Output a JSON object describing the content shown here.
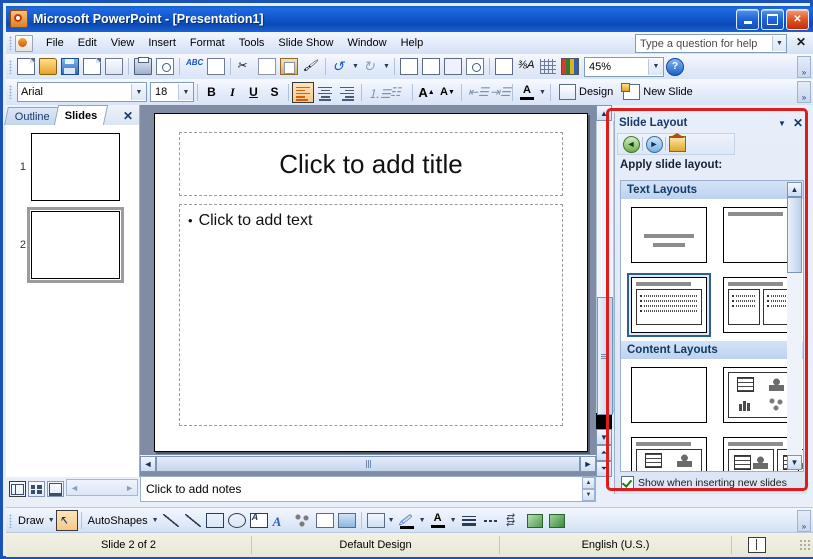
{
  "window": {
    "title": "Microsoft PowerPoint - [Presentation1]",
    "app_icon": "powerpoint-icon",
    "minimize": "_",
    "maximize": "□",
    "close": "✕"
  },
  "menu": {
    "items": [
      {
        "label": "File"
      },
      {
        "label": "Edit"
      },
      {
        "label": "View"
      },
      {
        "label": "Insert"
      },
      {
        "label": "Format"
      },
      {
        "label": "Tools"
      },
      {
        "label": "Slide Show"
      },
      {
        "label": "Window"
      },
      {
        "label": "Help"
      }
    ],
    "help_box": {
      "placeholder": "Type a question for help",
      "value": "Type a question for help"
    },
    "help_close": "✕"
  },
  "standard_toolbar": {
    "buttons": [
      {
        "name": "new-icon",
        "tip": "New"
      },
      {
        "name": "open-icon",
        "tip": "Open"
      },
      {
        "name": "save-icon",
        "tip": "Save"
      },
      {
        "name": "permission-icon",
        "tip": "Permission"
      },
      {
        "name": "email-icon",
        "tip": "E-mail"
      },
      {
        "name": "print-icon",
        "tip": "Print"
      },
      {
        "name": "print-preview-icon",
        "tip": "Print Preview"
      },
      {
        "name": "spelling-icon",
        "tip": "Spelling"
      },
      {
        "name": "research-icon",
        "tip": "Research"
      },
      {
        "name": "cut-icon",
        "tip": "Cut"
      },
      {
        "name": "copy-icon",
        "tip": "Copy"
      },
      {
        "name": "paste-icon",
        "tip": "Paste"
      },
      {
        "name": "format-painter-icon",
        "tip": "Format Painter"
      },
      {
        "name": "undo-icon",
        "tip": "Undo"
      },
      {
        "name": "redo-icon",
        "tip": "Redo"
      },
      {
        "name": "insert-chart-icon",
        "tip": "Insert Chart"
      },
      {
        "name": "insert-table-icon",
        "tip": "Insert Table"
      },
      {
        "name": "insert-hyperlink-icon",
        "tip": "Insert Hyperlink"
      },
      {
        "name": "expand-all-icon",
        "tip": "Expand All"
      },
      {
        "name": "show-formatting-icon",
        "tip": "Show Formatting"
      },
      {
        "name": "grid-guides-icon",
        "tip": "Show/Hide Grid"
      },
      {
        "name": "color-grayscale-icon",
        "tip": "Color/Grayscale"
      }
    ],
    "zoom": {
      "value": "45%"
    },
    "help_button": "?",
    "overflow": "»"
  },
  "formatting_toolbar": {
    "font": {
      "value": "Arial"
    },
    "size": {
      "value": "18"
    },
    "bold": "B",
    "italic": "I",
    "underline": "U",
    "shadow": "S",
    "align_left": "align-left",
    "align_center": "align-center",
    "align_right": "align-right",
    "numbering": "numbering",
    "bullets": "bullets",
    "increase_font": "A",
    "decrease_font": "A",
    "decrease_indent": "decrease-indent",
    "increase_indent": "increase-indent",
    "font_color": "A",
    "design_label": "Design",
    "new_slide_label": "New Slide",
    "overflow": "»"
  },
  "left_pane": {
    "tabs": [
      {
        "label": "Outline",
        "active": false
      },
      {
        "label": "Slides",
        "active": true
      }
    ],
    "close": "✕",
    "slides": [
      {
        "number": "1",
        "selected": false
      },
      {
        "number": "2",
        "selected": true
      }
    ]
  },
  "slide": {
    "title_placeholder": "Click to add title",
    "body_placeholder": "Click to add text",
    "bullet_char": "•"
  },
  "notes": {
    "placeholder": "Click to add notes"
  },
  "view_buttons": [
    {
      "name": "normal-view-button",
      "active": true
    },
    {
      "name": "slide-sorter-view-button",
      "active": false
    },
    {
      "name": "slide-show-button",
      "active": false
    }
  ],
  "task_pane": {
    "title": "Slide Layout",
    "caret": "▼",
    "close": "✕",
    "nav": [
      {
        "name": "back-button",
        "glyph": "◄"
      },
      {
        "name": "forward-button",
        "glyph": "►"
      },
      {
        "name": "home-button",
        "glyph": ""
      }
    ],
    "apply_label": "Apply slide layout:",
    "sections": [
      {
        "label": "Text Layouts",
        "layouts": [
          {
            "name": "title-slide-layout",
            "selected": false
          },
          {
            "name": "title-only-layout",
            "selected": false
          },
          {
            "name": "title-and-text-layout",
            "selected": true
          },
          {
            "name": "title-and-2-column-text-layout",
            "selected": false
          }
        ]
      },
      {
        "label": "Content Layouts",
        "layouts": [
          {
            "name": "blank-layout",
            "selected": false
          },
          {
            "name": "content-layout",
            "selected": false
          },
          {
            "name": "title-and-content-layout",
            "selected": false
          },
          {
            "name": "title-and-two-content-layout",
            "selected": false
          }
        ]
      }
    ],
    "show_when_inserting": {
      "label": "Show when inserting new slides",
      "checked": true
    },
    "scroll_up": "▲",
    "scroll_down": "▼"
  },
  "drawing_toolbar": {
    "draw_label": "Draw",
    "autoshapes_label": "AutoShapes",
    "tools": [
      {
        "name": "select-objects-icon",
        "active": true
      },
      {
        "name": "line-icon"
      },
      {
        "name": "arrow-icon"
      },
      {
        "name": "rectangle-icon"
      },
      {
        "name": "oval-icon"
      },
      {
        "name": "text-box-icon"
      },
      {
        "name": "wordart-icon"
      },
      {
        "name": "diagram-icon"
      },
      {
        "name": "clip-art-icon"
      },
      {
        "name": "picture-icon"
      },
      {
        "name": "fill-color-icon"
      },
      {
        "name": "line-color-icon"
      },
      {
        "name": "font-color-icon"
      },
      {
        "name": "line-style-icon"
      },
      {
        "name": "dash-style-icon"
      },
      {
        "name": "arrow-style-icon"
      },
      {
        "name": "shadow-style-icon"
      },
      {
        "name": "3d-style-icon"
      }
    ],
    "overflow": "»"
  },
  "status_bar": {
    "slide_counter": "Slide 2 of 2",
    "design": "Default Design",
    "language": "English (U.S.)",
    "spell_icon": "spell-check-icon"
  },
  "colors": {
    "titlebar_blue": "#1257cf",
    "annotation_red": "#e01b1b",
    "selection_blue": "#2e5f8f",
    "accent_orange": "#d4600f"
  }
}
